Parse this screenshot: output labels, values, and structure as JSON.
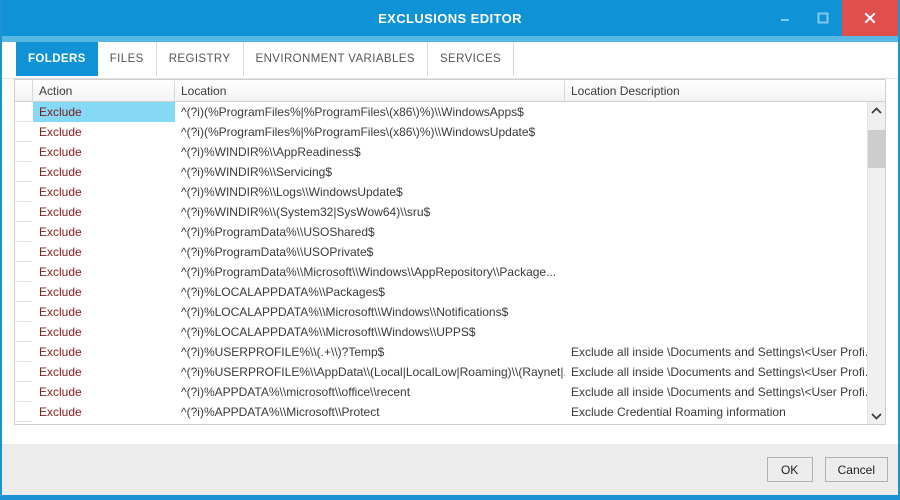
{
  "window": {
    "title": "EXCLUSIONS EDITOR",
    "minimize_label": "Minimize",
    "maximize_label": "Maximize",
    "close_label": "Close",
    "accent_color": "#1093d6",
    "close_color": "#e04f4b"
  },
  "tabs": [
    {
      "label": "FOLDERS",
      "active": true
    },
    {
      "label": "FILES",
      "active": false
    },
    {
      "label": "REGISTRY",
      "active": false
    },
    {
      "label": "ENVIRONMENT VARIABLES",
      "active": false
    },
    {
      "label": "SERVICES",
      "active": false
    }
  ],
  "grid": {
    "columns": [
      {
        "key": "action",
        "label": "Action"
      },
      {
        "key": "location",
        "label": "Location"
      },
      {
        "key": "description",
        "label": "Location Description"
      }
    ],
    "selected_row_color": "#86d9f5",
    "action_text_color": "#8b1a1a",
    "rows": [
      {
        "action": "Exclude",
        "location": "^(?i)(%ProgramFiles%|%ProgramFiles\\(x86\\)%)\\\\WindowsApps$",
        "description": "",
        "selected": true
      },
      {
        "action": "Exclude",
        "location": "^(?i)(%ProgramFiles%|%ProgramFiles\\(x86\\)%)\\\\WindowsUpdate$",
        "description": "",
        "selected": false
      },
      {
        "action": "Exclude",
        "location": "^(?i)%WINDIR%\\\\AppReadiness$",
        "description": "",
        "selected": false
      },
      {
        "action": "Exclude",
        "location": "^(?i)%WINDIR%\\\\Servicing$",
        "description": "",
        "selected": false
      },
      {
        "action": "Exclude",
        "location": "^(?i)%WINDIR%\\\\Logs\\\\WindowsUpdate$",
        "description": "",
        "selected": false
      },
      {
        "action": "Exclude",
        "location": "^(?i)%WINDIR%\\\\(System32|SysWow64)\\\\sru$",
        "description": "",
        "selected": false
      },
      {
        "action": "Exclude",
        "location": "^(?i)%ProgramData%\\\\USOShared$",
        "description": "",
        "selected": false
      },
      {
        "action": "Exclude",
        "location": "^(?i)%ProgramData%\\\\USOPrivate$",
        "description": "",
        "selected": false
      },
      {
        "action": "Exclude",
        "location": "^(?i)%ProgramData%\\\\Microsoft\\\\Windows\\\\AppRepository\\\\Package...",
        "description": "",
        "selected": false
      },
      {
        "action": "Exclude",
        "location": "^(?i)%LOCALAPPDATA%\\\\Packages$",
        "description": "",
        "selected": false
      },
      {
        "action": "Exclude",
        "location": "^(?i)%LOCALAPPDATA%\\\\Microsoft\\\\Windows\\\\Notifications$",
        "description": "",
        "selected": false
      },
      {
        "action": "Exclude",
        "location": "^(?i)%LOCALAPPDATA%\\\\Microsoft\\\\Windows\\\\UPPS$",
        "description": "",
        "selected": false
      },
      {
        "action": "Exclude",
        "location": "^(?i)%USERPROFILE%\\\\(.+\\\\)?Temp$",
        "description": "Exclude all inside \\Documents and Settings\\<User Profi...",
        "selected": false
      },
      {
        "action": "Exclude",
        "location": "^(?i)%USERPROFILE%\\\\AppData\\\\(Local|LocalLow|Roaming)\\\\(Raynet|...",
        "description": "Exclude all inside \\Documents and Settings\\<User Profi...",
        "selected": false
      },
      {
        "action": "Exclude",
        "location": "^(?i)%APPDATA%\\\\microsoft\\\\office\\\\recent",
        "description": "Exclude all inside \\Documents and Settings\\<User Profi...",
        "selected": false
      },
      {
        "action": "Exclude",
        "location": "^(?i)%APPDATA%\\\\Microsoft\\\\Protect",
        "description": "Exclude Credential Roaming information",
        "selected": false
      }
    ]
  },
  "scrollbar": {
    "up_icon": "chevron-up",
    "down_icon": "chevron-down"
  },
  "footer": {
    "ok_label": "OK",
    "cancel_label": "Cancel"
  }
}
